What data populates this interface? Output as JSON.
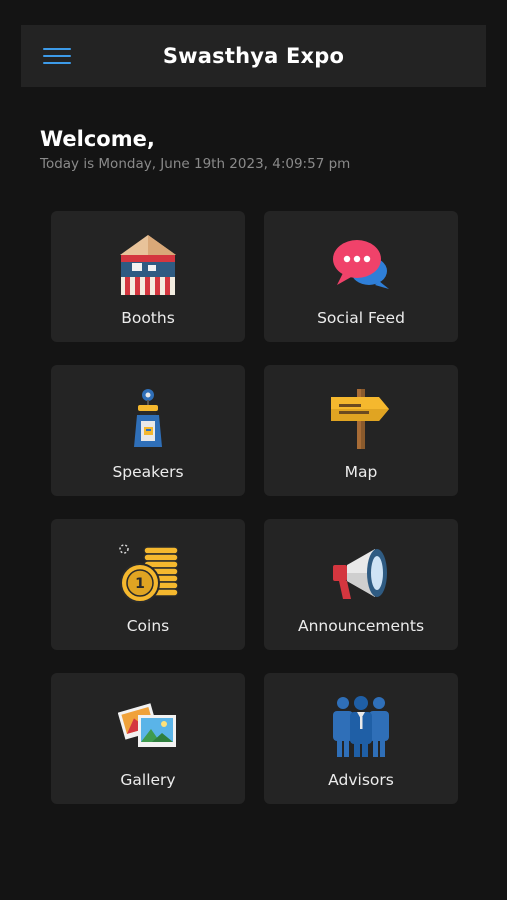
{
  "header": {
    "title": "Swasthya Expo",
    "menu_icon": "hamburger-menu-icon",
    "accent": "#3d9be9"
  },
  "welcome": {
    "title": "Welcome,",
    "date_line": "Today is Monday, June 19th 2023, 4:09:57 pm"
  },
  "tiles": [
    {
      "label": "Booths",
      "icon": "booth-stall-icon"
    },
    {
      "label": "Social Feed",
      "icon": "chat-bubbles-icon"
    },
    {
      "label": "Speakers",
      "icon": "speaker-podium-icon"
    },
    {
      "label": "Map",
      "icon": "signpost-icon"
    },
    {
      "label": "Coins",
      "icon": "coins-icon"
    },
    {
      "label": "Announcements",
      "icon": "megaphone-icon"
    },
    {
      "label": "Gallery",
      "icon": "photos-icon"
    },
    {
      "label": "Advisors",
      "icon": "advisors-group-icon"
    }
  ],
  "colors": {
    "background": "#141414",
    "card": "#242424",
    "appbar": "#232323"
  }
}
